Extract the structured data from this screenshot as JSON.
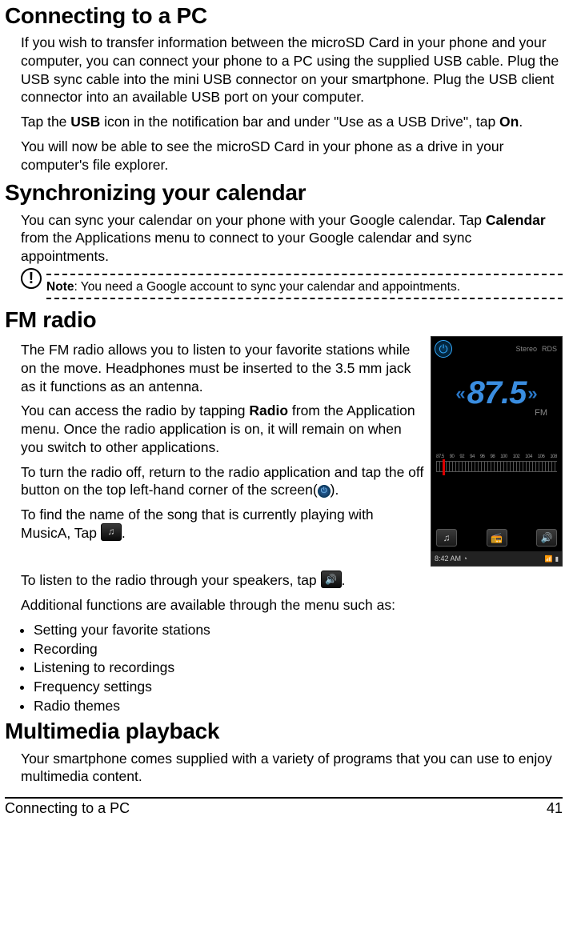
{
  "sections": {
    "pc": {
      "title": "Connecting to a PC",
      "p1": "If you wish to transfer information between the microSD Card in your phone and your computer, you can connect your phone to a PC using the supplied USB cable. Plug the USB sync cable into the mini USB connector on your smartphone. Plug the USB client connector into an available USB port on your computer.",
      "p2_pre": "Tap the ",
      "p2_bold1": "USB",
      "p2_mid": " icon in the notification bar and under \"Use as a USB Drive\", tap ",
      "p2_bold2": "On",
      "p2_post": ".",
      "p3": "You will now be able to see the microSD Card in your phone as a drive in your computer's file explorer."
    },
    "cal": {
      "title": "Synchronizing your calendar",
      "p1_pre": "You can sync your calendar on your phone with your Google calendar. Tap ",
      "p1_bold": "Calendar",
      "p1_post": " from the Applications menu to connect to your Google calendar and sync appointments.",
      "note_label": "Note",
      "note_text": ": You need a Google account to sync your calendar and appointments."
    },
    "fm": {
      "title": "FM radio",
      "p1": "The FM radio allows you to listen to your favorite stations while on the move. Headphones must be inserted to the 3.5 mm jack as it functions as an antenna.",
      "p2_pre": "You can access the radio by tapping ",
      "p2_bold": "Radio",
      "p2_post": " from the Application menu. Once the radio application is on, it will remain on when you switch to other applications.",
      "p3": "To turn the radio off, return to the radio application and tap the off button on the top left-hand corner of the screen(",
      "p3_post": ").",
      "p4": "To find the name of the song that is currently playing with MusicA, Tap ",
      "p4_post": ".",
      "p5": "To listen to the radio through your speakers, tap ",
      "p5_post": ".",
      "p6": "Additional functions are available through the menu such as:",
      "features": [
        "Setting your favorite stations",
        "Recording",
        "Listening to recordings",
        "Frequency settings",
        "Radio themes"
      ],
      "phone": {
        "badge1": "Stereo",
        "badge2": "RDS",
        "freq": "87.5",
        "band": "FM",
        "dial": [
          "87.5",
          "90",
          "92",
          "94",
          "96",
          "98",
          "100",
          "102",
          "104",
          "106",
          "108"
        ],
        "time": "8:42 AM"
      }
    },
    "mm": {
      "title": "Multimedia playback",
      "p1": "Your smartphone comes supplied with a variety of programs that you can use to enjoy multimedia content."
    }
  },
  "footer": {
    "left": "Connecting to a PC",
    "right": "41"
  }
}
